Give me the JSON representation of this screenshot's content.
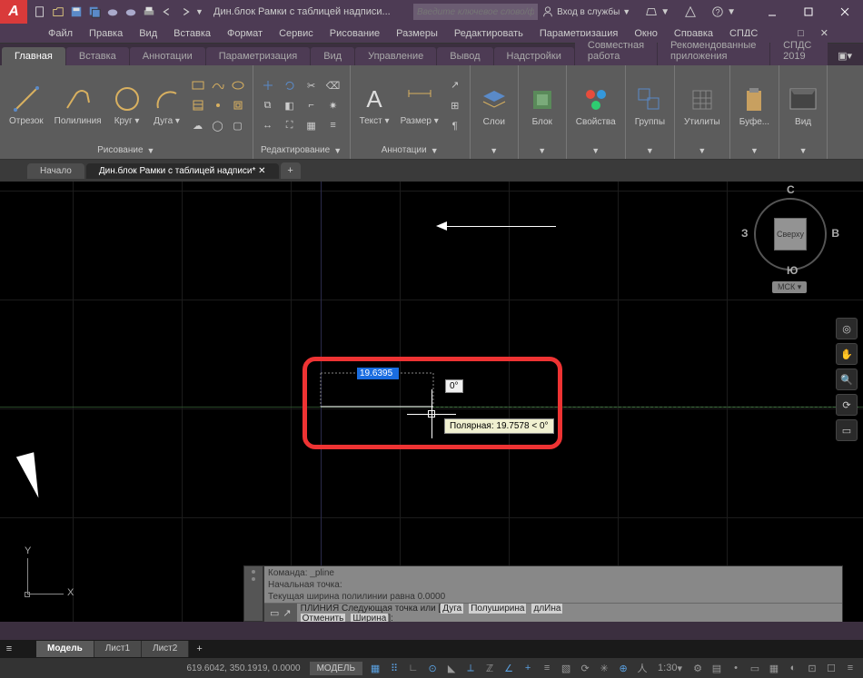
{
  "app": {
    "logo": "A",
    "title": "Дин.блок Рамки с таблицей надписи...",
    "search_placeholder": "Введите ключевое слово/фразу",
    "login": "Вход в службы"
  },
  "menu": [
    "Файл",
    "Правка",
    "Вид",
    "Вставка",
    "Формат",
    "Сервис",
    "Рисование",
    "Размеры",
    "Редактировать",
    "Параметризация",
    "Окно",
    "Справка",
    "СПДС"
  ],
  "ribbon_tabs": [
    "Главная",
    "Вставка",
    "Аннотации",
    "Параметризация",
    "Вид",
    "Управление",
    "Вывод",
    "Надстройки",
    "Совместная работа",
    "Рекомендованные приложения",
    "СПДС 2019"
  ],
  "ribbon": {
    "draw": {
      "label": "Рисование",
      "line": "Отрезок",
      "polyline": "Полилиния",
      "circle": "Круг",
      "arc": "Дуга"
    },
    "modify": {
      "label": "Редактирование"
    },
    "annotation": {
      "label": "Аннотации",
      "text": "Текст",
      "dim": "Размер"
    },
    "layers": {
      "label": "Слои"
    },
    "block": {
      "label": "Блок"
    },
    "properties": {
      "label": "Свойства"
    },
    "groups": {
      "label": "Группы"
    },
    "utilities": {
      "label": "Утилиты"
    },
    "clipboard": {
      "label": "Буфе..."
    },
    "view": {
      "label": "Вид"
    }
  },
  "doctabs": {
    "start": "Начало",
    "doc1": "Дин.блок Рамки с таблицей надписи*"
  },
  "viewcube": {
    "face": "Сверху",
    "n": "С",
    "s": "Ю",
    "e": "В",
    "w": "З",
    "mck": "МСК"
  },
  "drawing": {
    "length_input": "19.6395",
    "angle": "0°",
    "polar_tip": "Полярная: 19.7578 < 0°"
  },
  "ucs": {
    "x": "X",
    "y": "Y"
  },
  "command": {
    "hist1": "Команда: _pline",
    "hist2": "Начальная точка:",
    "hist3": "Текущая ширина полилинии равна 0.0000",
    "prompt_pre": "ПЛИНИЯ Следующая точка или [",
    "opt_arc": "Дуга",
    "opt_half": "Полуширина",
    "opt_len": "длИна",
    "opt_undo": "Отменить",
    "opt_width": "Ширина",
    "prompt_post": "]:"
  },
  "status": {
    "coords": "619.6042, 350.1919, 0.0000",
    "model": "МОДЕЛЬ",
    "scale": "1:30"
  },
  "model_tabs": [
    "Модель",
    "Лист1",
    "Лист2"
  ]
}
